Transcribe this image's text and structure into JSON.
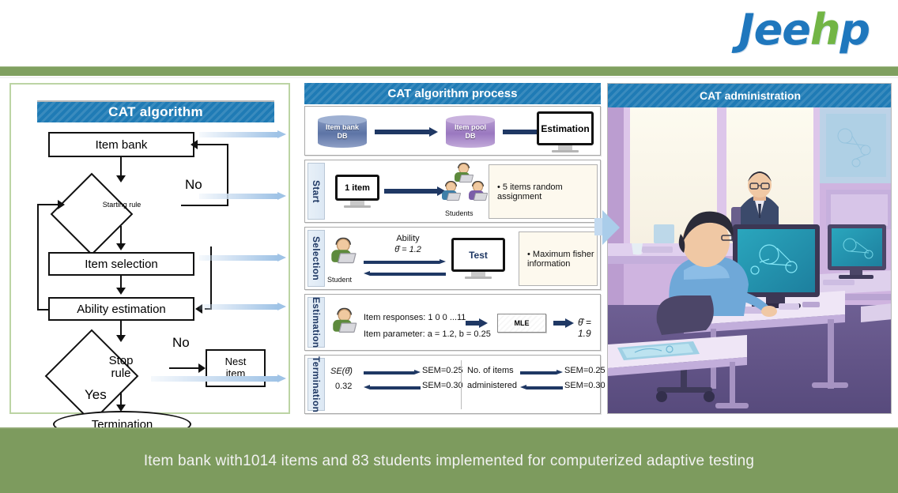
{
  "brand": {
    "part1": "Jee",
    "part2": "h",
    "part3": "p"
  },
  "left_panel": {
    "title": "CAT algorithm",
    "nodes": {
      "item_bank": "Item bank",
      "starting_rule": "Starting rule",
      "item_selection": "Item selection",
      "ability_estimation": "Ability estimation",
      "stop_rule_line1": "Stop",
      "stop_rule_line2": "rule",
      "nest_item_line1": "Nest",
      "nest_item_line2": "item",
      "termination": "Termination"
    },
    "labels": {
      "no_1": "No",
      "no_2": "No",
      "yes": "Yes"
    }
  },
  "middle_panel": {
    "title": "CAT algorithm process",
    "overview": {
      "item_bank_db_line1": "Item bank",
      "item_bank_db_line2": "DB",
      "item_pool_db_line1": "Item pool",
      "item_pool_db_line2": "DB",
      "estimation": "Estimation"
    },
    "rows": [
      {
        "tab": "Start",
        "monitor": "1 item",
        "students_label": "Students",
        "note": "• 5 items random assignment"
      },
      {
        "tab": "Selection",
        "student_label": "Student",
        "ability_label": "Ability",
        "ability_value": "θ̂ = 1.2",
        "test": "Test",
        "note": "• Maximum fisher information"
      },
      {
        "tab": "Estimation",
        "item_responses": "Item responses: 1 0 0 ...11",
        "item_parameter": "Item parameter: a = 1.2, b = 0.25",
        "method": "MLE",
        "result": "θ̂ = 1.9"
      },
      {
        "tab": "Termination",
        "se_label": "SE(θ̂)",
        "se_value": "0.32",
        "sem_top_left": "SEM=0.25",
        "sem_bottom_left": "SEM=0.30",
        "items_label_line1": "No. of items",
        "items_label_line2": "administered",
        "sem_top_right": "SEM=0.25",
        "sem_bottom_right": "SEM=0.30"
      }
    ]
  },
  "right_panel": {
    "title": "CAT administration"
  },
  "caption": {
    "text": "Item bank with1014 items and 83 students implemented for computerized adaptive testing"
  },
  "colors": {
    "header_blue": "#1f7bb5",
    "brand_blue": "#1f77bd",
    "brand_green": "#72b545",
    "caption_green": "#7d9b5e",
    "navy": "#1f3864",
    "panel_border_green": "#bcd4a4"
  }
}
